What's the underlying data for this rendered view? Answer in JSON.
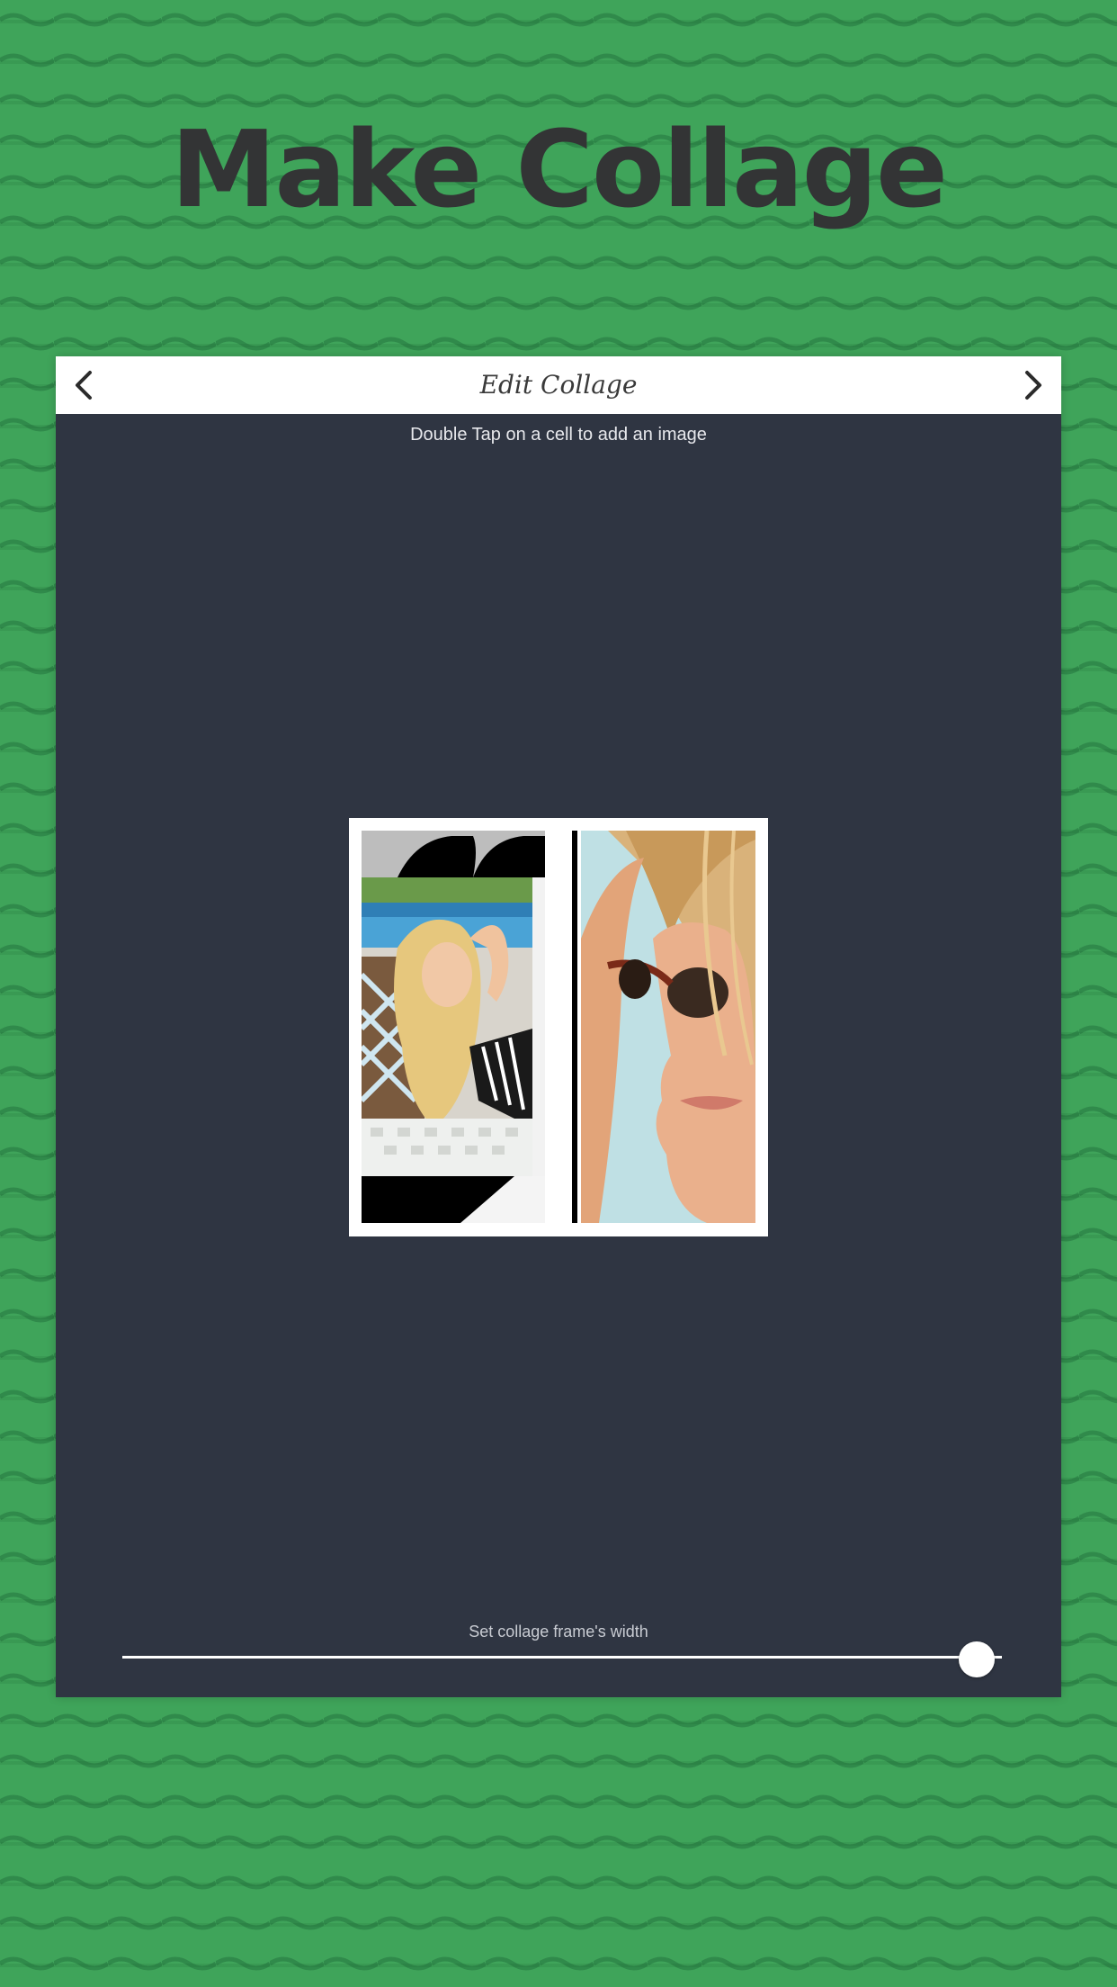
{
  "hero": {
    "title": "Make Collage"
  },
  "navbar": {
    "title": "Edit Collage",
    "back_icon": "chevron-left-icon",
    "forward_icon": "chevron-right-icon"
  },
  "editor": {
    "hint": "Double Tap on a cell to add an image"
  },
  "collage": {
    "cells": [
      {
        "content": "photo-woman-poolside"
      },
      {
        "content": "photo-woman-sunglasses"
      }
    ]
  },
  "frame_width_slider": {
    "label": "Set collage frame's width",
    "value_fraction": 1.0
  },
  "colors": {
    "background": "#3fa45a",
    "panel": "#2f3542",
    "title": "#333435",
    "navbar": "#ffffff"
  }
}
